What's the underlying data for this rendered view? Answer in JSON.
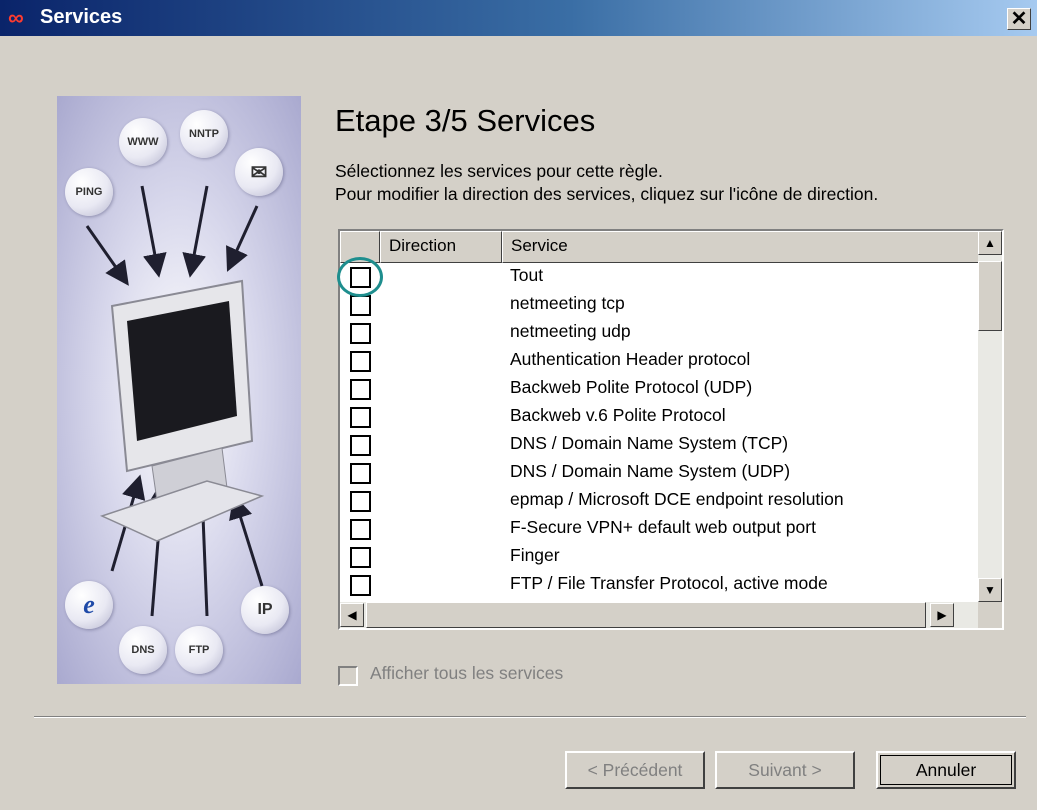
{
  "window": {
    "title": "Services"
  },
  "sidebar": {
    "bubbles": [
      "WWW",
      "NNTP",
      "PING",
      "mail-icon",
      "e-icon",
      "IP",
      "DNS",
      "FTP"
    ],
    "bubble_labels": {
      "www": "WWW",
      "nntp": "NNTP",
      "ping": "PING",
      "ip": "IP",
      "dns": "DNS",
      "ftp": "FTP"
    }
  },
  "step": {
    "heading": "Etape 3/5 Services",
    "line1": "Sélectionnez les services pour cette règle.",
    "line2": "Pour modifier la direction des services, cliquez sur l'icône de direction."
  },
  "list": {
    "columns": {
      "direction": "Direction",
      "service": "Service"
    },
    "rows": [
      "Tout",
      "netmeeting tcp",
      "netmeeting udp",
      "Authentication Header protocol",
      "Backweb Polite Protocol (UDP)",
      "Backweb v.6 Polite Protocol",
      "DNS / Domain Name System (TCP)",
      "DNS / Domain Name System (UDP)",
      "epmap / Microsoft DCE endpoint resolution",
      "F-Secure VPN+ default web output port",
      "Finger",
      "FTP / File Transfer Protocol, active mode"
    ]
  },
  "show_all": {
    "label": "Afficher tous les services",
    "checked": false,
    "enabled": false
  },
  "buttons": {
    "previous": "< Précédent",
    "next": "Suivant >",
    "cancel": "Annuler"
  },
  "colors": {
    "highlight": "#1e8e8e",
    "title_start": "#0a246a",
    "title_end": "#a6caf0"
  }
}
